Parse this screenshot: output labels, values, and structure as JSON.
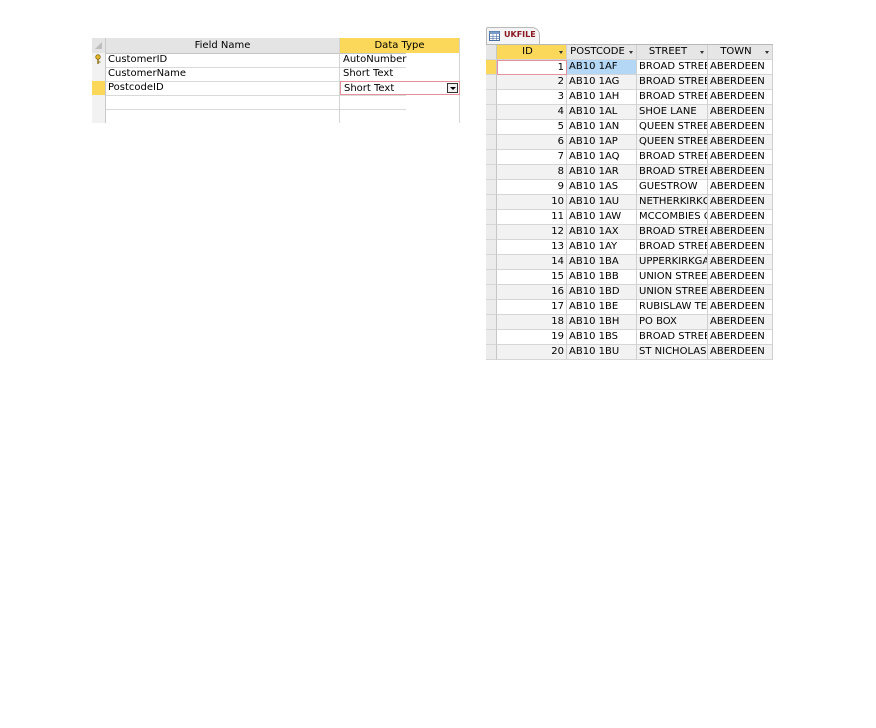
{
  "design": {
    "headers": {
      "field_name": "Field Name",
      "data_type": "Data Type"
    },
    "fields": [
      {
        "name": "CustomerID",
        "type": "AutoNumber",
        "key": true
      },
      {
        "name": "CustomerName",
        "type": "Short Text",
        "key": false
      },
      {
        "name": "PostcodeID",
        "type": "Short Text",
        "key": false,
        "selected": true
      }
    ]
  },
  "sheet": {
    "tab_label": "UKFILE",
    "headers": {
      "id": "ID",
      "postcode": "POSTCODE",
      "street": "STREET",
      "town": "TOWN"
    },
    "rows": [
      {
        "id": "1",
        "postcode": "AB10 1AF",
        "street": "BROAD STREET",
        "town": "ABERDEEN"
      },
      {
        "id": "2",
        "postcode": "AB10 1AG",
        "street": "BROAD STREET",
        "town": "ABERDEEN"
      },
      {
        "id": "3",
        "postcode": "AB10 1AH",
        "street": "BROAD STREET",
        "town": "ABERDEEN"
      },
      {
        "id": "4",
        "postcode": "AB10 1AL",
        "street": "SHOE LANE",
        "town": "ABERDEEN"
      },
      {
        "id": "5",
        "postcode": "AB10 1AN",
        "street": "QUEEN STREET",
        "town": "ABERDEEN"
      },
      {
        "id": "6",
        "postcode": "AB10 1AP",
        "street": "QUEEN STREET",
        "town": "ABERDEEN"
      },
      {
        "id": "7",
        "postcode": "AB10 1AQ",
        "street": "BROAD STREET",
        "town": "ABERDEEN"
      },
      {
        "id": "8",
        "postcode": "AB10 1AR",
        "street": "BROAD STREET",
        "town": "ABERDEEN"
      },
      {
        "id": "9",
        "postcode": "AB10 1AS",
        "street": "GUESTROW",
        "town": "ABERDEEN"
      },
      {
        "id": "10",
        "postcode": "AB10 1AU",
        "street": "NETHERKIRKGA",
        "town": "ABERDEEN"
      },
      {
        "id": "11",
        "postcode": "AB10 1AW",
        "street": "MCCOMBIES CO",
        "town": "ABERDEEN"
      },
      {
        "id": "12",
        "postcode": "AB10 1AX",
        "street": "BROAD STREET",
        "town": "ABERDEEN"
      },
      {
        "id": "13",
        "postcode": "AB10 1AY",
        "street": "BROAD STREET",
        "town": "ABERDEEN"
      },
      {
        "id": "14",
        "postcode": "AB10 1BA",
        "street": "UPPERKIRKGAT",
        "town": "ABERDEEN"
      },
      {
        "id": "15",
        "postcode": "AB10 1BB",
        "street": "UNION STREET",
        "town": "ABERDEEN"
      },
      {
        "id": "16",
        "postcode": "AB10 1BD",
        "street": "UNION STREET",
        "town": "ABERDEEN"
      },
      {
        "id": "17",
        "postcode": "AB10 1BE",
        "street": "RUBISLAW TER",
        "town": "ABERDEEN"
      },
      {
        "id": "18",
        "postcode": "AB10 1BH",
        "street": "PO BOX",
        "town": "ABERDEEN"
      },
      {
        "id": "19",
        "postcode": "AB10 1BS",
        "street": "BROAD STREET",
        "town": "ABERDEEN"
      },
      {
        "id": "20",
        "postcode": "AB10 1BU",
        "street": "ST NICHOLAS S",
        "town": "ABERDEEN"
      }
    ]
  },
  "colors": {
    "header_highlight": "#fbd85a",
    "selected_cell": "#b3d7f5",
    "edit_border": "#e7929a",
    "tab_text": "#8a1822"
  }
}
